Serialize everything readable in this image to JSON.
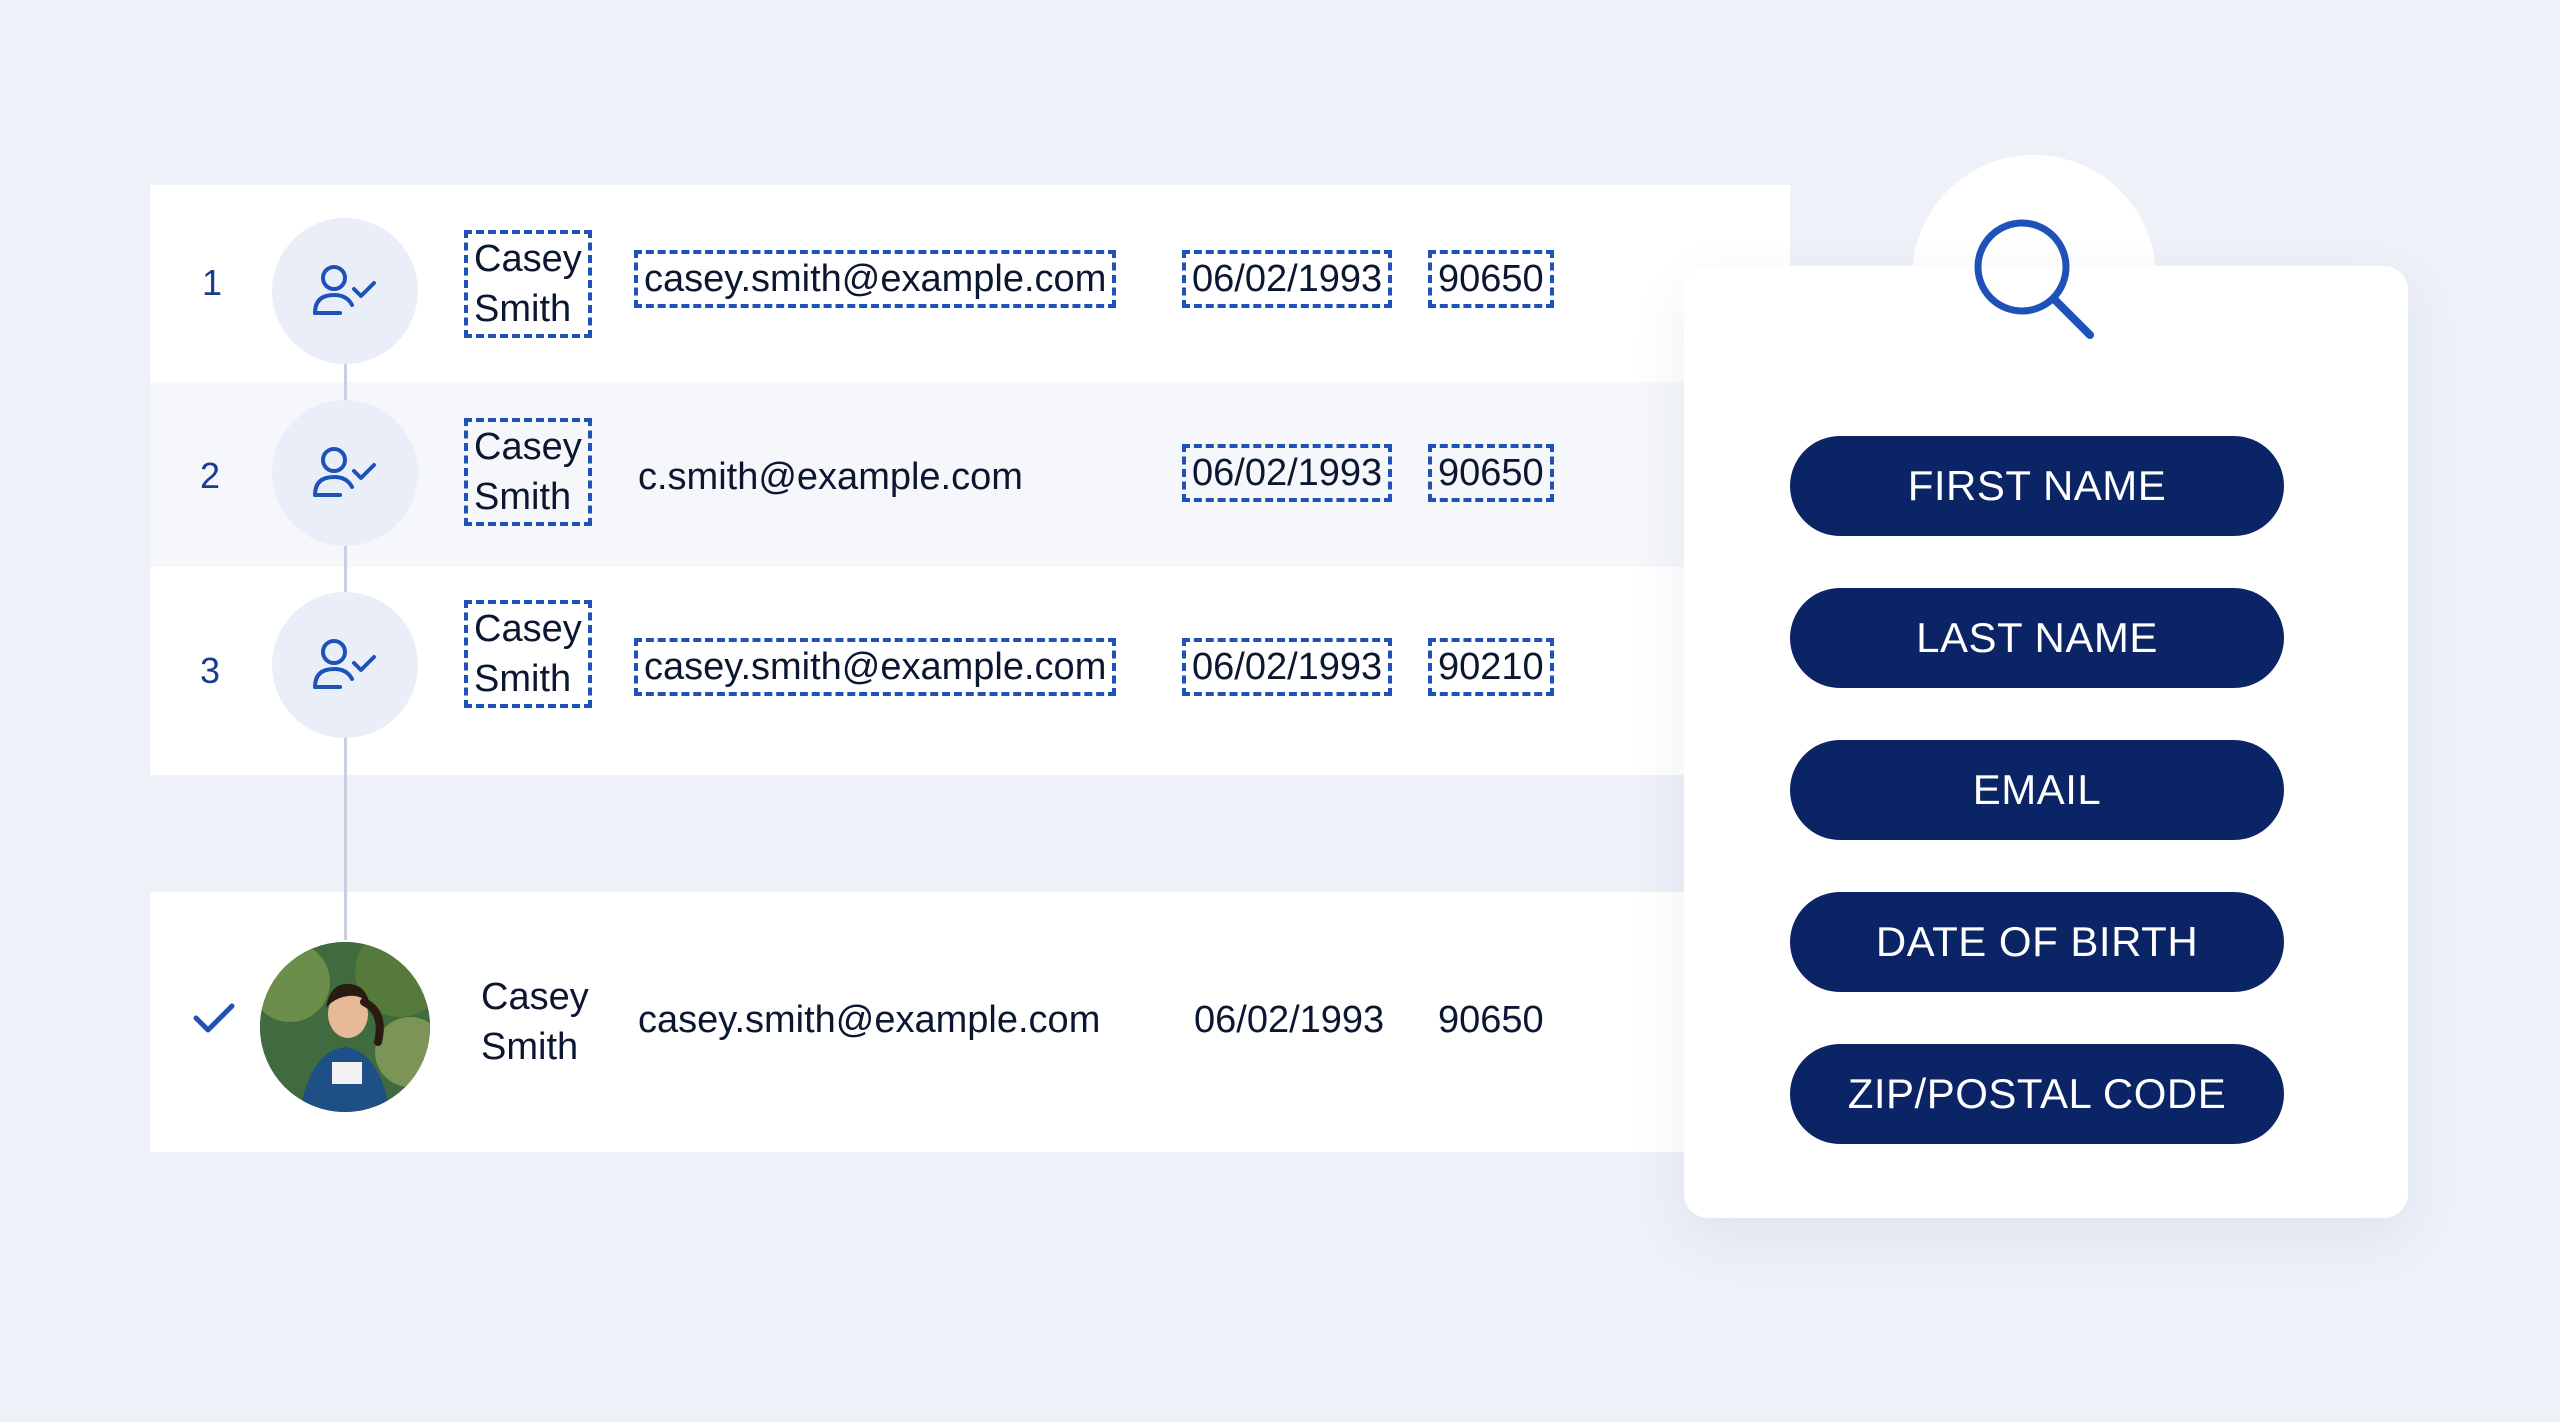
{
  "records": [
    {
      "index": "1",
      "first": "Casey",
      "last": "Smith",
      "email": "casey.smith@example.com",
      "dob": "06/02/1993",
      "zip": "90650"
    },
    {
      "index": "2",
      "first": "Casey",
      "last": "Smith",
      "email": "c.smith@example.com",
      "dob": "06/02/1993",
      "zip": "90650"
    },
    {
      "index": "3",
      "first": "Casey",
      "last": "Smith",
      "email": "casey.smith@example.com",
      "dob": "06/02/1993",
      "zip": "90210"
    }
  ],
  "golden": {
    "first": "Casey",
    "last": "Smith",
    "email": "casey.smith@example.com",
    "dob": "06/02/1993",
    "zip": "90650"
  },
  "match_fields": [
    "FIRST NAME",
    "LAST NAME",
    "EMAIL",
    "DATE OF BIRTH",
    "ZIP/POSTAL CODE"
  ],
  "icons": {
    "record": "user-check-icon",
    "search": "search-icon",
    "match": "check-icon"
  },
  "colors": {
    "accent": "#1f52b8",
    "pill": "#0a2466",
    "background": "#eef1f8"
  }
}
